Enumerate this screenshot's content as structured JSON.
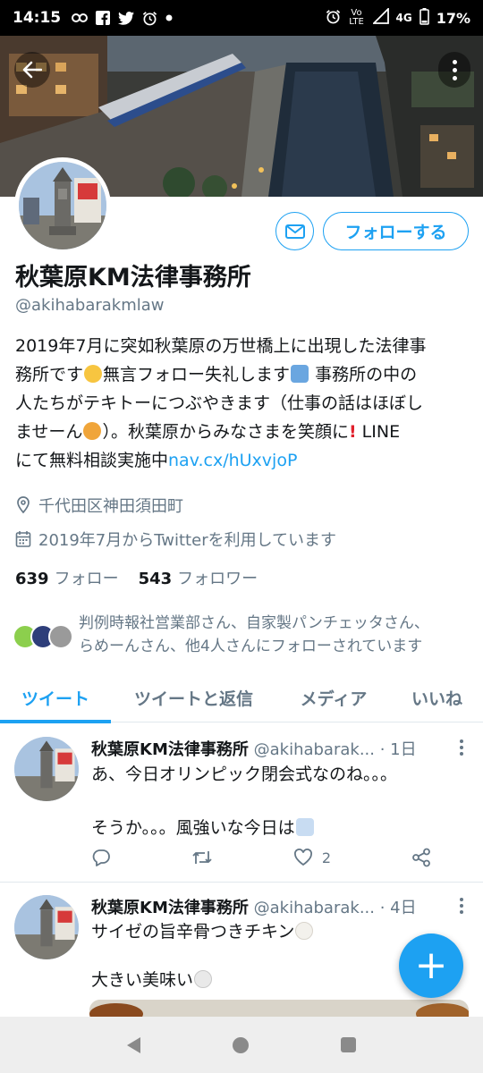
{
  "status_bar": {
    "time": "14:15",
    "network": "4G",
    "volte": "Vo LTE",
    "battery": "17%",
    "left_icons": [
      "link-icon",
      "facebook-icon",
      "twitter-icon",
      "alarm-icon",
      "dot-icon"
    ],
    "right_icons": [
      "alarm-icon",
      "volte-icon",
      "signal-icon",
      "battery-icon"
    ]
  },
  "profile": {
    "display_name": "秋葉原KM法律事務所",
    "handle": "@akihabarakmlaw",
    "follow_label": "フォローする",
    "bio": {
      "line1": "2019年7月に突如秋葉原の万世橋上に出現した法律事",
      "line2a": "務所です",
      "line2b": "無言フォロー失礼します",
      "line2c": " 事務所の中の",
      "line3": "人たちがテキトーにつぶやきます（仕事の話はほぼし",
      "line4a": "ませーん",
      "line4b": "）。秋葉原からみなさまを笑顔に",
      "line4c": " LINE",
      "line5a": "にて無料相談実施中",
      "link": "nav.cx/hUxvjoP"
    },
    "location": "千代田区神田須田町",
    "joined": "2019年7月からTwitterを利用しています",
    "following_count": "639",
    "following_label": "フォロー",
    "followers_count": "543",
    "followers_label": "フォロワー",
    "followed_by_line1": "判例時報社営業部さん、自家製パンチェッタさん、",
    "followed_by_line2": "らめーんさん、他4人さんにフォローされています"
  },
  "tabs": [
    {
      "label": "ツイート",
      "active": true
    },
    {
      "label": "ツイートと返信",
      "active": false
    },
    {
      "label": "メディア",
      "active": false
    },
    {
      "label": "いいね",
      "active": false
    }
  ],
  "tweets": [
    {
      "name": "秋葉原KM法律事務所",
      "handle": "@akihabarak...",
      "time": "· 1日",
      "line1": "あ、今日オリンピック閉会式なのね。。。",
      "line2": "そうか。。。風強いな今日は",
      "reply_count": "",
      "retweet_count": "",
      "like_count": "2"
    },
    {
      "name": "秋葉原KM法律事務所",
      "handle": "@akihabarak...",
      "time": "· 4日",
      "line1": "サイゼの旨辛骨つきチキン",
      "line2": "大きい美味い"
    }
  ],
  "fab_label": "+",
  "colors": {
    "accent": "#1da1f2",
    "text": "#14171a",
    "secondary": "#657786",
    "divider": "#e1e8ed"
  }
}
